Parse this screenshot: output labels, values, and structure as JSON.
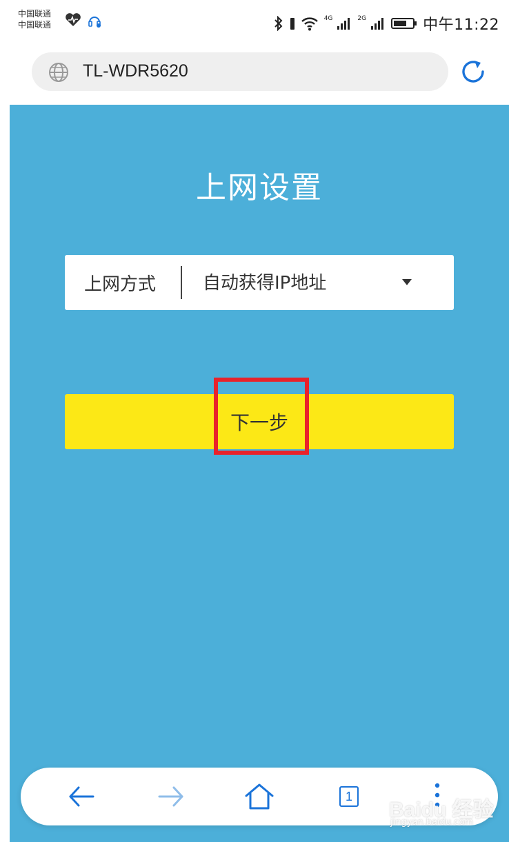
{
  "status_bar": {
    "carrier_1": "中国联通",
    "carrier_2": "中国联通",
    "signal_1_label": "4G",
    "signal_2_label": "2G",
    "time": "中午11:22",
    "icons": [
      "heart-icon",
      "headset-icon",
      "bluetooth-icon",
      "wifi-icon",
      "signal-icon",
      "battery-icon"
    ]
  },
  "address_bar": {
    "url": "TL-WDR5620",
    "icons": [
      "globe-icon",
      "reload-icon"
    ]
  },
  "page": {
    "title": "上网设置",
    "connection_label": "上网方式",
    "connection_value": "自动获得IP地址",
    "next_button": "下一步"
  },
  "bottom_nav": {
    "tab_count": "1",
    "icons": [
      "back-arrow-icon",
      "forward-arrow-icon",
      "home-icon",
      "tabs-icon",
      "more-icon"
    ]
  },
  "watermark": {
    "logo": "Baidu 经验",
    "url": "jingyan.baidu.com"
  },
  "colors": {
    "page_background": "#4cafd9",
    "button_background": "#fce816",
    "highlight": "#e8232b",
    "accent_blue": "#1a73d9"
  }
}
